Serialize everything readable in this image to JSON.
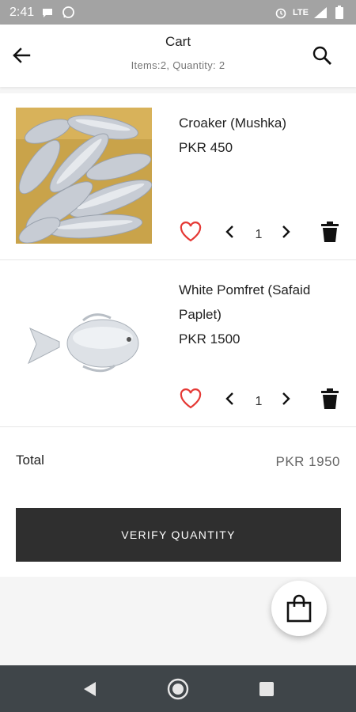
{
  "status_bar": {
    "time": "2:41",
    "network": "LTE",
    "icons": [
      "chat-bubble-icon",
      "whatsapp-icon",
      "alarm-icon",
      "signal-icon",
      "battery-icon"
    ]
  },
  "header": {
    "title": "Cart",
    "subtitle": "Items:2, Quantity: 2"
  },
  "items": [
    {
      "name": "Croaker (Mushka)",
      "price": "PKR 450",
      "quantity": "1",
      "image": "croaker-fish-pile"
    },
    {
      "name": "White Pomfret (Safaid Paplet)",
      "price": "PKR 1500",
      "quantity": "1",
      "image": "white-pomfret-fish"
    }
  ],
  "summary": {
    "total_label": "Total",
    "total_value": "PKR  1950"
  },
  "actions": {
    "verify_label": "VERIFY QUANTITY"
  },
  "colors": {
    "heart": "#e53935",
    "button": "#2f2f2f",
    "nav_bar": "#3f4549",
    "status_bar": "#a3a3a3"
  }
}
